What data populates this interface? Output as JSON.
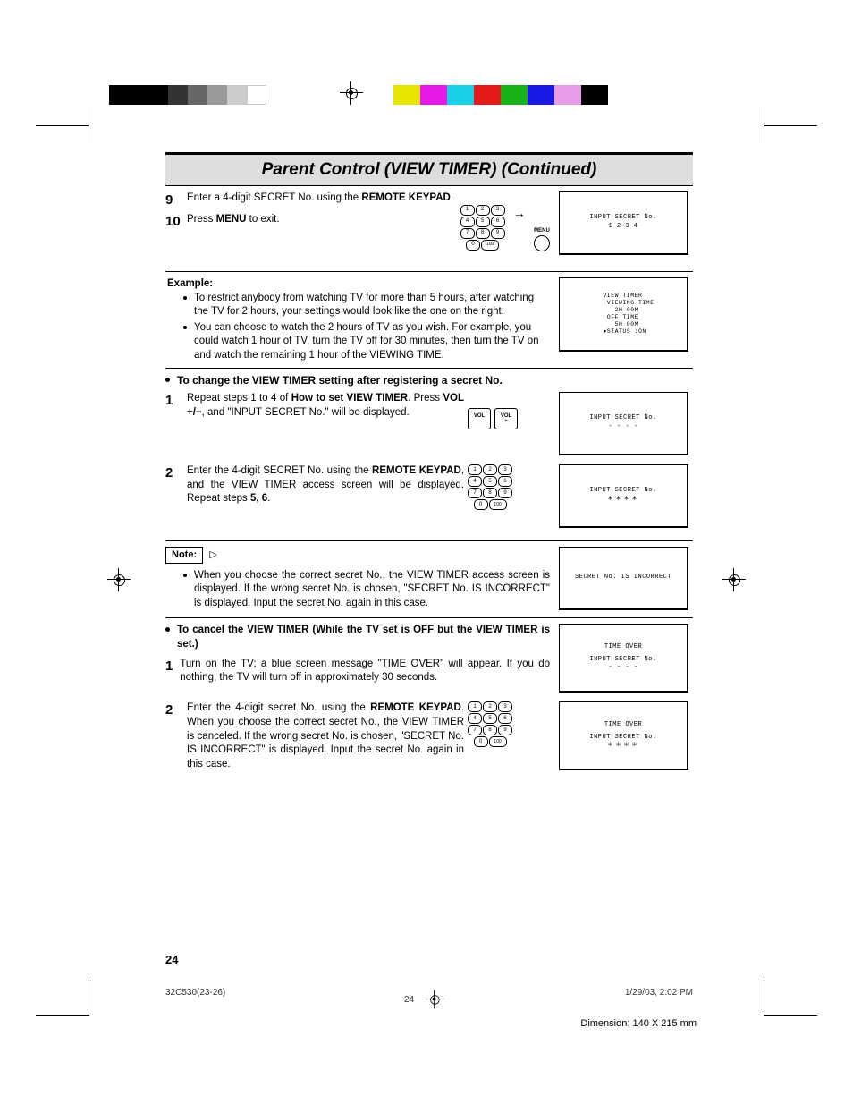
{
  "title": "Parent Control (VIEW TIMER) (Continued)",
  "step9_num": "9",
  "step9_a": "Enter a 4-digit SECRET No. using the ",
  "step9_b": "REMOTE KEYPAD",
  "step9_c": ".",
  "step10_num": "10",
  "step10_a": "Press ",
  "step10_b": "MENU",
  "step10_c": " to exit.",
  "menu_label": "MENU",
  "screen1_l1": "INPUT SECRET No.",
  "screen1_l2": "1 2 3 4",
  "example_heading": "Example:",
  "example_b1": "To restrict anybody from watching TV for more than 5 hours, after watching the TV for 2 hours, your settings would look like the one on the right.",
  "example_b2": "You can choose to watch the 2 hours of TV as you wish. For example, you could watch 1 hour of TV, turn the TV off for 30 minutes, then turn the TV on and watch the remaining 1 hour of the VIEWING TIME.",
  "screen2": "VIEW TIMER\n VIEWING TIME\n   2H 00M\n OFF TIME\n   5H 00M\n●STATUS :ON",
  "change_heading": "To change the VIEW TIMER setting after registering a secret No.",
  "c_step1_num": "1",
  "c_step1_a": "Repeat steps 1 to 4 of ",
  "c_step1_b": "How to set VIEW TIMER",
  "c_step1_c": ". Press ",
  "c_step1_d": "VOL +/−",
  "c_step1_e": ", and \"INPUT SECRET No.\" will be displayed.",
  "vol_label": "VOL",
  "screen3_l1": "INPUT SECRET No.",
  "screen3_l2": "- - - -",
  "c_step2_num": "2",
  "c_step2_a": "Enter the 4-digit SECRET No. using the ",
  "c_step2_b": "REMOTE KEYPAD",
  "c_step2_c": ", and the VIEW TIMER access screen will be displayed. Repeat steps ",
  "c_step2_d": "5, 6",
  "c_step2_e": ".",
  "screen4_l1": "INPUT SECRET No.",
  "screen4_l2": "＊＊＊＊",
  "note_label": "Note:",
  "note_bullet": "When you choose the correct secret No., the VIEW TIMER access screen is displayed. If the wrong secret No. is chosen, \"SECRET No. IS INCORRECT\" is displayed. Input the secret No. again in this case.",
  "screen5": "SECRET No. IS INCORRECT",
  "cancel_heading": "To cancel the VIEW TIMER (While the TV set is OFF but the VIEW TIMER is set.)",
  "d_step1_num": "1",
  "d_step1": "Turn on the TV; a blue screen message \"TIME OVER\" will appear. If you do nothing, the TV will turn off in approximately 30 seconds.",
  "screen6_l1": "TIME OVER",
  "screen6_l2": "INPUT SECRET No.",
  "screen6_l3": "- - - -",
  "d_step2_num": "2",
  "d_step2_a": "Enter the 4-digit secret No. using the ",
  "d_step2_b": "REMOTE KEYPAD",
  "d_step2_c": ". When you choose the correct secret No., the VIEW TIMER is canceled. If the wrong secret No. is chosen, \"SECRET No. IS INCORRECT\" is displayed. Input the secret No. again in this case.",
  "screen7_l1": "TIME OVER",
  "screen7_l2": "INPUT SECRET No.",
  "screen7_l3": "＊＊＊＊",
  "page_number": "24",
  "footer_left": "32C530(23-26)",
  "footer_mid": "24",
  "footer_right": "1/29/03, 2:02 PM",
  "dimension": "Dimension: 140  X 215 mm",
  "keys": {
    "k1": "1",
    "k2": "2",
    "k3": "3",
    "k4": "4",
    "k5": "5",
    "k6": "6",
    "k7": "7",
    "k8": "8",
    "k9": "9",
    "k0": "0",
    "k100": "100"
  }
}
